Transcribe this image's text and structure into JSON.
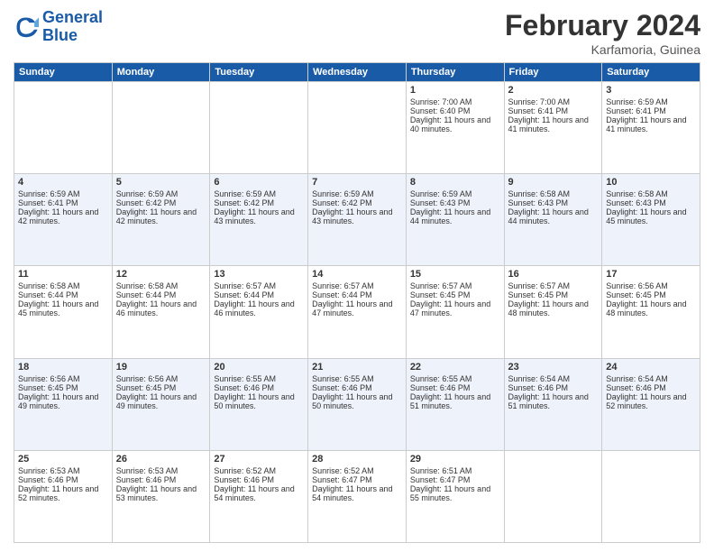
{
  "header": {
    "logo_line1": "General",
    "logo_line2": "Blue",
    "month": "February 2024",
    "location": "Karfamoria, Guinea"
  },
  "weekdays": [
    "Sunday",
    "Monday",
    "Tuesday",
    "Wednesday",
    "Thursday",
    "Friday",
    "Saturday"
  ],
  "weeks": [
    [
      {
        "day": "",
        "empty": true
      },
      {
        "day": "",
        "empty": true
      },
      {
        "day": "",
        "empty": true
      },
      {
        "day": "",
        "empty": true
      },
      {
        "day": "1",
        "sunrise": "7:00 AM",
        "sunset": "6:40 PM",
        "daylight": "11 hours and 40 minutes."
      },
      {
        "day": "2",
        "sunrise": "7:00 AM",
        "sunset": "6:41 PM",
        "daylight": "11 hours and 41 minutes."
      },
      {
        "day": "3",
        "sunrise": "6:59 AM",
        "sunset": "6:41 PM",
        "daylight": "11 hours and 41 minutes."
      }
    ],
    [
      {
        "day": "4",
        "sunrise": "6:59 AM",
        "sunset": "6:41 PM",
        "daylight": "11 hours and 42 minutes."
      },
      {
        "day": "5",
        "sunrise": "6:59 AM",
        "sunset": "6:42 PM",
        "daylight": "11 hours and 42 minutes."
      },
      {
        "day": "6",
        "sunrise": "6:59 AM",
        "sunset": "6:42 PM",
        "daylight": "11 hours and 43 minutes."
      },
      {
        "day": "7",
        "sunrise": "6:59 AM",
        "sunset": "6:42 PM",
        "daylight": "11 hours and 43 minutes."
      },
      {
        "day": "8",
        "sunrise": "6:59 AM",
        "sunset": "6:43 PM",
        "daylight": "11 hours and 44 minutes."
      },
      {
        "day": "9",
        "sunrise": "6:58 AM",
        "sunset": "6:43 PM",
        "daylight": "11 hours and 44 minutes."
      },
      {
        "day": "10",
        "sunrise": "6:58 AM",
        "sunset": "6:43 PM",
        "daylight": "11 hours and 45 minutes."
      }
    ],
    [
      {
        "day": "11",
        "sunrise": "6:58 AM",
        "sunset": "6:44 PM",
        "daylight": "11 hours and 45 minutes."
      },
      {
        "day": "12",
        "sunrise": "6:58 AM",
        "sunset": "6:44 PM",
        "daylight": "11 hours and 46 minutes."
      },
      {
        "day": "13",
        "sunrise": "6:57 AM",
        "sunset": "6:44 PM",
        "daylight": "11 hours and 46 minutes."
      },
      {
        "day": "14",
        "sunrise": "6:57 AM",
        "sunset": "6:44 PM",
        "daylight": "11 hours and 47 minutes."
      },
      {
        "day": "15",
        "sunrise": "6:57 AM",
        "sunset": "6:45 PM",
        "daylight": "11 hours and 47 minutes."
      },
      {
        "day": "16",
        "sunrise": "6:57 AM",
        "sunset": "6:45 PM",
        "daylight": "11 hours and 48 minutes."
      },
      {
        "day": "17",
        "sunrise": "6:56 AM",
        "sunset": "6:45 PM",
        "daylight": "11 hours and 48 minutes."
      }
    ],
    [
      {
        "day": "18",
        "sunrise": "6:56 AM",
        "sunset": "6:45 PM",
        "daylight": "11 hours and 49 minutes."
      },
      {
        "day": "19",
        "sunrise": "6:56 AM",
        "sunset": "6:45 PM",
        "daylight": "11 hours and 49 minutes."
      },
      {
        "day": "20",
        "sunrise": "6:55 AM",
        "sunset": "6:46 PM",
        "daylight": "11 hours and 50 minutes."
      },
      {
        "day": "21",
        "sunrise": "6:55 AM",
        "sunset": "6:46 PM",
        "daylight": "11 hours and 50 minutes."
      },
      {
        "day": "22",
        "sunrise": "6:55 AM",
        "sunset": "6:46 PM",
        "daylight": "11 hours and 51 minutes."
      },
      {
        "day": "23",
        "sunrise": "6:54 AM",
        "sunset": "6:46 PM",
        "daylight": "11 hours and 51 minutes."
      },
      {
        "day": "24",
        "sunrise": "6:54 AM",
        "sunset": "6:46 PM",
        "daylight": "11 hours and 52 minutes."
      }
    ],
    [
      {
        "day": "25",
        "sunrise": "6:53 AM",
        "sunset": "6:46 PM",
        "daylight": "11 hours and 52 minutes."
      },
      {
        "day": "26",
        "sunrise": "6:53 AM",
        "sunset": "6:46 PM",
        "daylight": "11 hours and 53 minutes."
      },
      {
        "day": "27",
        "sunrise": "6:52 AM",
        "sunset": "6:46 PM",
        "daylight": "11 hours and 54 minutes."
      },
      {
        "day": "28",
        "sunrise": "6:52 AM",
        "sunset": "6:47 PM",
        "daylight": "11 hours and 54 minutes."
      },
      {
        "day": "29",
        "sunrise": "6:51 AM",
        "sunset": "6:47 PM",
        "daylight": "11 hours and 55 minutes."
      },
      {
        "day": "",
        "empty": true
      },
      {
        "day": "",
        "empty": true
      }
    ]
  ]
}
